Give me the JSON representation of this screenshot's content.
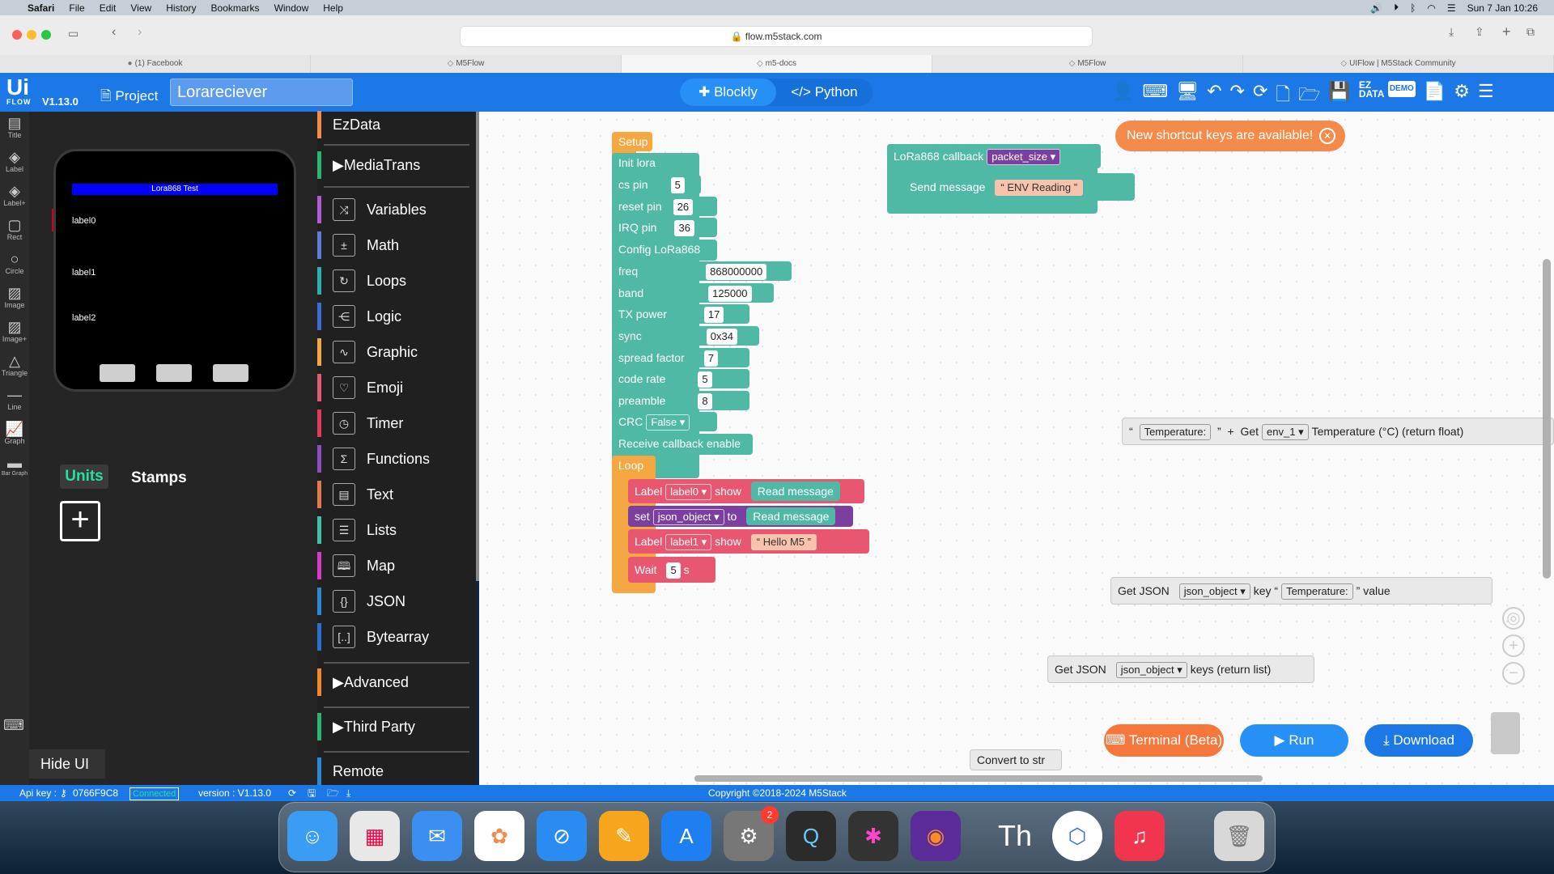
{
  "menubar": {
    "app": "Safari",
    "items": [
      "File",
      "Edit",
      "View",
      "History",
      "Bookmarks",
      "Window",
      "Help"
    ],
    "clock": "Sun 7 Jan  10:26"
  },
  "browser": {
    "url": "flow.m5stack.com",
    "tabs": [
      {
        "label": "(1) Facebook"
      },
      {
        "label": "M5Flow"
      },
      {
        "label": "m5-docs"
      },
      {
        "label": "M5Flow"
      },
      {
        "label": "UIFlow | M5Stack Community"
      }
    ]
  },
  "header": {
    "logo": "Ui",
    "logo_sub": "FLOW",
    "version": "V1.13.0",
    "project_label": "Project",
    "project_name": "Lorareciever",
    "mode_blockly": "Blockly",
    "mode_python": "Python",
    "ez_data": "EZ DATA",
    "demo": "DEMO"
  },
  "tools": [
    "Title",
    "Label",
    "Label+",
    "Rect",
    "Circle",
    "Image",
    "Image+",
    "Triangle",
    "Line",
    "Graph",
    "Bar Graph"
  ],
  "device": {
    "screen_title": "Lora868 Test",
    "labels": [
      "label0",
      "label1",
      "label2"
    ]
  },
  "panel": {
    "units": "Units",
    "stamps": "Stamps",
    "hide_ui": "Hide UI"
  },
  "categories": [
    {
      "label": "EzData",
      "color": "#f58b4a"
    },
    {
      "label": "MediaTrans",
      "color": "#2bb673"
    },
    {
      "label": "Variables",
      "color": "#b35ad7"
    },
    {
      "label": "Math",
      "color": "#5c7dd6"
    },
    {
      "label": "Loops",
      "color": "#2bb0b0"
    },
    {
      "label": "Logic",
      "color": "#3b6dd6"
    },
    {
      "label": "Graphic",
      "color": "#f5a742"
    },
    {
      "label": "Emoji",
      "color": "#e05a7a"
    },
    {
      "label": "Timer",
      "color": "#e23a5a"
    },
    {
      "label": "Functions",
      "color": "#8a4fbf"
    },
    {
      "label": "Text",
      "color": "#e37a4f"
    },
    {
      "label": "Lists",
      "color": "#3fc2a5"
    },
    {
      "label": "Map",
      "color": "#d63ac9"
    },
    {
      "label": "JSON",
      "color": "#2b8ad6"
    },
    {
      "label": "Bytearray",
      "color": "#2b6fd6"
    },
    {
      "label": "Advanced",
      "color": "#f5862a"
    },
    {
      "label": "Third Party",
      "color": "#2bb673"
    },
    {
      "label": "Remote",
      "color": "#2b8ad6"
    }
  ],
  "blocks": {
    "setup": "Setup",
    "init_lora": "Init lora",
    "cs_pin": "cs pin",
    "cs_val": "5",
    "reset_pin": "reset pin",
    "reset_val": "26",
    "irq_pin": "IRQ pin",
    "irq_val": "36",
    "config": "Config LoRa868",
    "freq": "freq",
    "freq_val": "868000000",
    "band": "band",
    "band_val": "125000",
    "txp": "TX power",
    "txp_val": "17",
    "sync": "sync",
    "sync_val": "0x34",
    "sf": "spread factor",
    "sf_val": "7",
    "cr": "code rate",
    "cr_val": "5",
    "pre": "preamble",
    "pre_val": "8",
    "crc": "CRC",
    "crc_val": "False",
    "recv": "Receive callback enable",
    "loop": "Loop",
    "label_kw": "Label",
    "show_kw": "show",
    "label0": "label0",
    "read_msg": "Read message",
    "set_kw": "set",
    "to_kw": "to",
    "json_obj": "json_object",
    "label1": "label1",
    "hello": "Hello M5",
    "wait": "Wait",
    "wait_val": "5",
    "wait_unit": "s",
    "callback": "LoRa868 callback",
    "packet_size": "packet_size",
    "send_msg": "Send message",
    "env_reading": "ENV Reading",
    "temp_str": "Temperature:",
    "plus": "+",
    "get_kw": "Get",
    "env_1": "env_1",
    "temp_float": "Temperature (°C) (return float)",
    "get_json": "Get JSON",
    "key_kw": "key",
    "value_kw": "value",
    "keys_list": "keys (return list)",
    "convert": "Convert to str"
  },
  "toast": "New shortcut keys are available!",
  "actions": {
    "terminal": "Terminal (Beta)",
    "run": "Run",
    "download": "Download"
  },
  "status": {
    "api_key_label": "Api key :",
    "api_key": "0766F9C8",
    "connected": "Connected",
    "version": "version : V1.13.0",
    "copyright": "Copyright ©2018-2024 M5Stack"
  },
  "dock": {
    "settings_badge": "2",
    "th": "Th"
  },
  "colors": {
    "accent": "#1b78e6",
    "teal": "#4fb9a6",
    "loop_orange": "#f5a742",
    "red_block": "#e9566f",
    "units_green": "#25e0a0"
  }
}
